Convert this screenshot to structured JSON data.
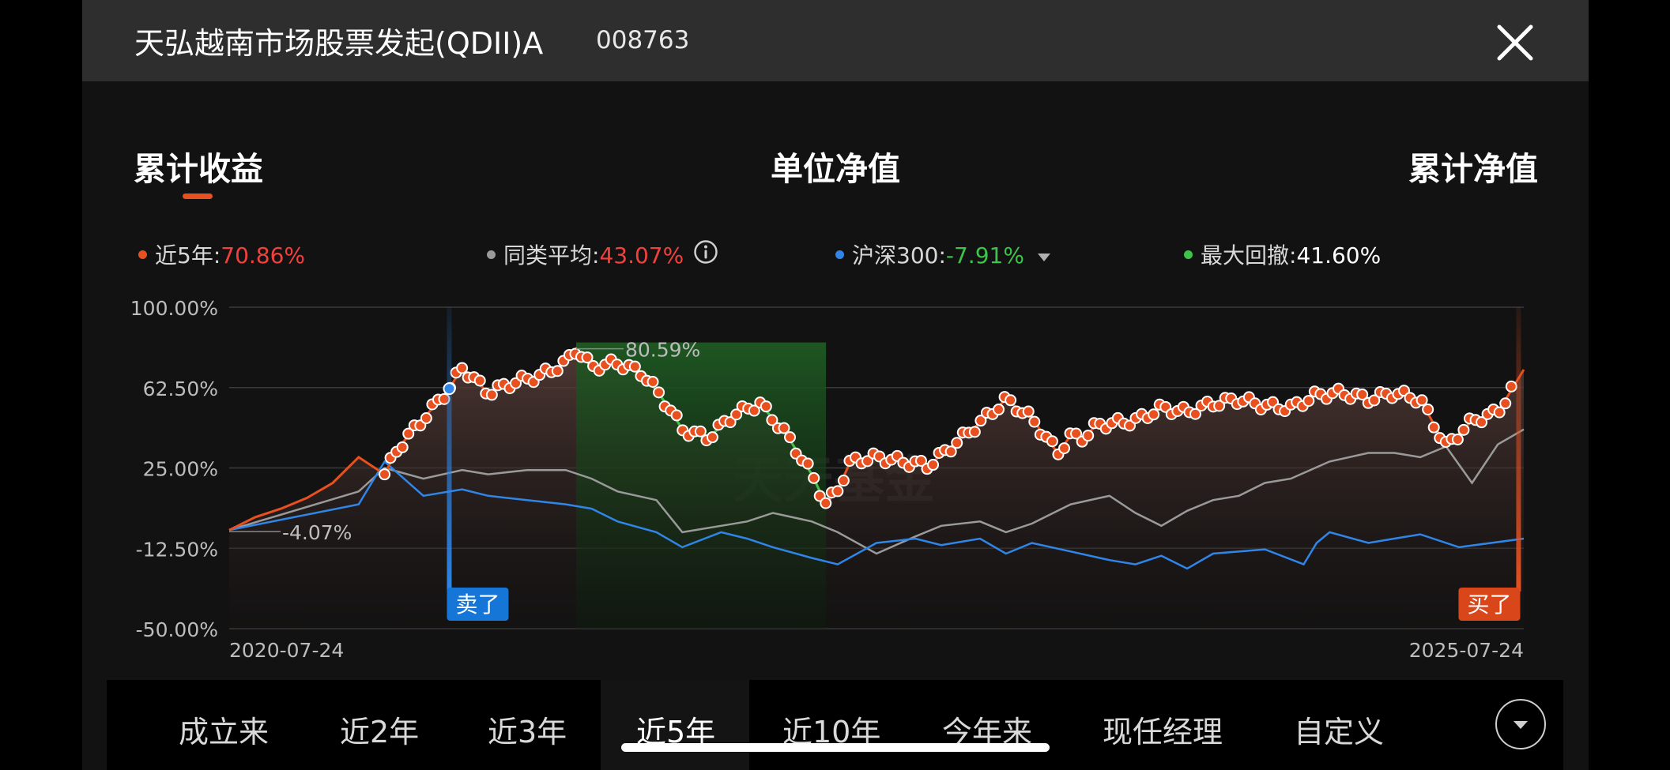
{
  "header": {
    "title": "天弘越南市场股票发起(QDII)A",
    "code": "008763",
    "close_icon": "close-icon"
  },
  "main_tabs": [
    {
      "label": "累计收益",
      "active": true
    },
    {
      "label": "单位净值",
      "active": false
    },
    {
      "label": "累计净值",
      "active": false
    }
  ],
  "legend": {
    "fund": {
      "label": "近5年:",
      "value": "70.86%",
      "color": "#e8501f"
    },
    "category_avg": {
      "label": "同类平均:",
      "value": "43.07%",
      "color": "#9a9a9a"
    },
    "benchmark": {
      "label": "沪深300:",
      "value": "-7.91%",
      "color": "#2f86e8"
    },
    "max_drawdown": {
      "label": "最大回撤:",
      "value": "41.60%",
      "color": "#3ec24b"
    }
  },
  "chart_data": {
    "type": "line",
    "y_ticks": [
      "100.00%",
      "62.50%",
      "25.00%",
      "-12.50%",
      "-50.00%"
    ],
    "ylim": [
      -50,
      100
    ],
    "x_start_label": "2020-07-24",
    "x_end_label": "2025-07-24",
    "watermark": "天天基金",
    "annotations": {
      "peak_label": "80.59%",
      "start_label": "-4.07%",
      "sell_label": "卖了",
      "buy_label": "买了"
    },
    "sell_at": 0.17,
    "buy_at": 0.996,
    "drawdown_range": [
      0.268,
      0.461
    ],
    "series": [
      {
        "name": "近5年",
        "color": "#e8501f",
        "x": [
          0,
          0.02,
          0.04,
          0.06,
          0.08,
          0.1,
          0.12,
          0.13,
          0.15,
          0.17,
          0.18,
          0.2,
          0.22,
          0.24,
          0.26,
          0.268,
          0.28,
          0.3,
          0.32,
          0.34,
          0.35,
          0.37,
          0.39,
          0.41,
          0.43,
          0.45,
          0.461,
          0.47,
          0.48,
          0.5,
          0.52,
          0.54,
          0.56,
          0.58,
          0.6,
          0.62,
          0.64,
          0.65,
          0.66,
          0.67,
          0.7,
          0.72,
          0.74,
          0.76,
          0.78,
          0.8,
          0.82,
          0.84,
          0.86,
          0.88,
          0.9,
          0.92,
          0.94,
          0.96,
          0.98,
          1.0
        ],
        "y": [
          -4,
          2,
          6,
          11,
          18,
          30,
          22,
          34,
          48,
          62,
          72,
          60,
          65,
          68,
          74,
          80.6,
          72,
          74,
          69,
          53,
          43,
          39,
          50,
          55,
          41,
          22,
          8,
          15,
          28,
          30,
          28,
          26,
          36,
          46,
          57,
          48,
          32,
          40,
          39,
          45,
          47,
          53,
          51,
          55,
          57,
          54,
          53,
          59,
          60,
          57,
          60,
          57,
          35,
          47,
          51,
          70.9
        ]
      },
      {
        "name": "同类平均",
        "color": "#9a9a9a",
        "x": [
          0,
          0.05,
          0.1,
          0.12,
          0.15,
          0.18,
          0.2,
          0.23,
          0.26,
          0.28,
          0.3,
          0.33,
          0.35,
          0.38,
          0.4,
          0.42,
          0.45,
          0.47,
          0.5,
          0.53,
          0.55,
          0.58,
          0.6,
          0.62,
          0.65,
          0.68,
          0.7,
          0.72,
          0.74,
          0.76,
          0.78,
          0.8,
          0.82,
          0.85,
          0.88,
          0.9,
          0.92,
          0.94,
          0.96,
          0.98,
          1.0
        ],
        "y": [
          -4,
          5,
          14,
          25,
          20,
          24,
          22,
          24,
          24,
          20,
          14,
          10,
          -5,
          -2,
          0,
          4,
          0,
          -5,
          -15,
          -7,
          -2,
          0,
          -5,
          -1,
          8,
          12,
          4,
          -2,
          5,
          10,
          12,
          18,
          20,
          28,
          32,
          32,
          30,
          35,
          18,
          36,
          43
        ]
      },
      {
        "name": "沪深300",
        "color": "#2f86e8",
        "x": [
          0,
          0.05,
          0.1,
          0.12,
          0.15,
          0.18,
          0.2,
          0.23,
          0.26,
          0.28,
          0.3,
          0.33,
          0.35,
          0.38,
          0.4,
          0.42,
          0.45,
          0.47,
          0.5,
          0.53,
          0.55,
          0.58,
          0.6,
          0.62,
          0.65,
          0.68,
          0.7,
          0.72,
          0.74,
          0.76,
          0.8,
          0.83,
          0.84,
          0.85,
          0.88,
          0.9,
          0.92,
          0.95,
          1.0
        ],
        "y": [
          -4,
          2,
          8,
          28,
          12,
          15,
          12,
          10,
          8,
          6,
          0,
          -5,
          -12,
          -5,
          -8,
          -12,
          -17,
          -20,
          -10,
          -8,
          -11,
          -8,
          -15,
          -10,
          -14,
          -18,
          -20,
          -16,
          -22,
          -15,
          -13,
          -20,
          -10,
          -5,
          -10,
          -8,
          -6,
          -12,
          -8
        ]
      }
    ]
  },
  "range_tabs": [
    {
      "label": "成立来",
      "active": false
    },
    {
      "label": "近2年",
      "active": false
    },
    {
      "label": "近3年",
      "active": false
    },
    {
      "label": "近5年",
      "active": true
    },
    {
      "label": "近10年",
      "active": false
    },
    {
      "label": "今年来",
      "active": false
    },
    {
      "label": "现任经理",
      "active": false
    },
    {
      "label": "自定义",
      "active": false
    }
  ],
  "more_icon": "chevron-down-icon"
}
